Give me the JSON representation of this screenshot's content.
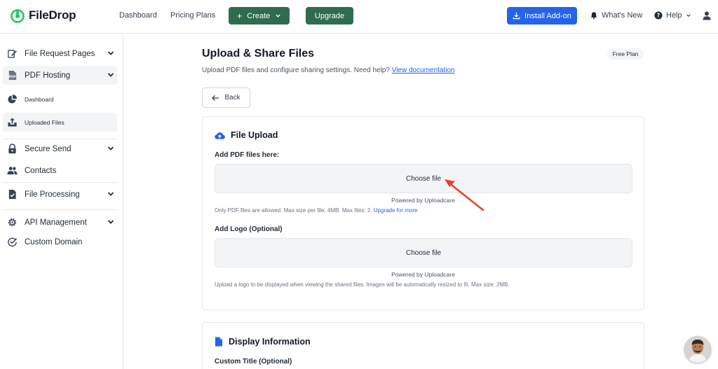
{
  "brand": {
    "name": "FileDrop",
    "color": "#22c55e"
  },
  "topnav": {
    "dashboard": "Dashboard",
    "pricing": "Pricing Plans",
    "create": "Create",
    "upgrade": "Upgrade",
    "install": "Install Add-on",
    "whats_new": "What's New",
    "help": "Help"
  },
  "sidebar": {
    "items": [
      {
        "label": "File Request Pages",
        "icon": "edit-icon",
        "chevron": true
      },
      {
        "label": "PDF Hosting",
        "icon": "pdf-icon",
        "chevron": true,
        "expanded": true
      },
      {
        "label": "Dashboard",
        "icon": "pie-chart-icon",
        "sub": true
      },
      {
        "label": "Uploaded Files",
        "icon": "upload-tray-icon",
        "sub": true,
        "active": true
      },
      {
        "label": "Secure Send",
        "icon": "lock-icon",
        "chevron": true
      },
      {
        "label": "Contacts",
        "icon": "users-icon"
      },
      {
        "label": "File Processing",
        "icon": "file-check-icon",
        "chevron": true
      },
      {
        "label": "API Management",
        "icon": "gear-icon",
        "chevron": true
      },
      {
        "label": "Custom Domain",
        "icon": "badge-check-icon"
      }
    ]
  },
  "main": {
    "title": "Upload & Share Files",
    "subtitle": "Upload PDF files and configure sharing settings. Need help?",
    "doc_link": "View documentation",
    "plan_badge": "Free Plan",
    "back": "Back"
  },
  "upload_card": {
    "title": "File Upload",
    "pdf_label": "Add PDF files here:",
    "choose": "Choose file",
    "powered": "Powered by Uploadcare",
    "pdf_hint": "Only PDF files are allowed. Max size per file: 4MB. Max files: 2.",
    "upgrade_link": "Upgrade for more",
    "logo_label": "Add Logo (Optional)",
    "logo_choose": "Choose file",
    "logo_powered": "Powered by Uploadcare",
    "logo_hint": "Upload a logo to be displayed when viewing the shared files. Images will be automatically resized to fit. Max size: 2MB."
  },
  "display_card": {
    "title": "Display Information",
    "custom_title_label": "Custom Title (Optional)"
  },
  "colors": {
    "primary_green": "#2f6b4f",
    "primary_blue": "#2463eb",
    "annotation_red": "#e5432f"
  }
}
